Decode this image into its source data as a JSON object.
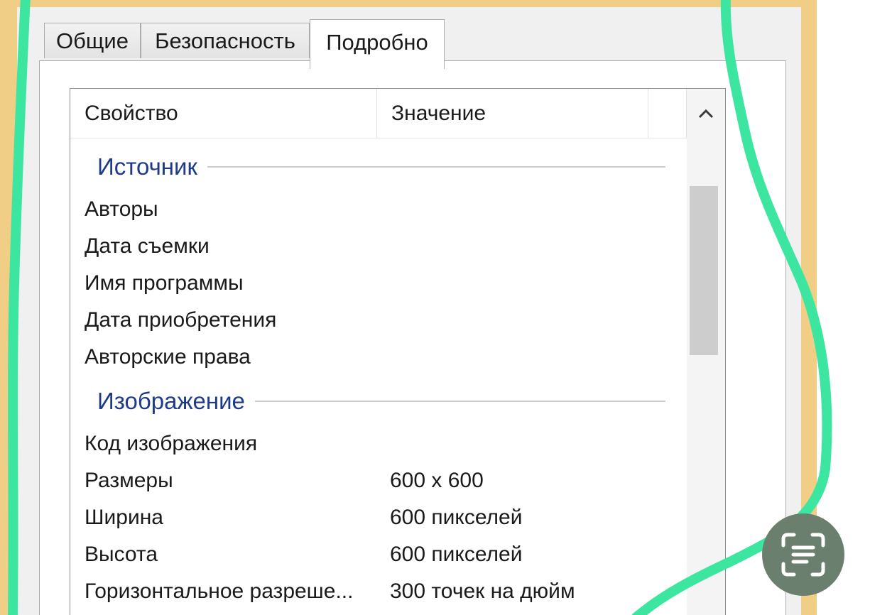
{
  "tabs": [
    {
      "label": "Общие",
      "active": false
    },
    {
      "label": "Безопасность",
      "active": false
    },
    {
      "label": "Подробно",
      "active": true
    }
  ],
  "list": {
    "columns": {
      "property": "Свойство",
      "value": "Значение"
    },
    "groups": [
      {
        "title": "Источник",
        "rows": [
          {
            "name": "Авторы",
            "value": ""
          },
          {
            "name": "Дата съемки",
            "value": ""
          },
          {
            "name": "Имя программы",
            "value": ""
          },
          {
            "name": "Дата приобретения",
            "value": ""
          },
          {
            "name": "Авторские права",
            "value": ""
          }
        ]
      },
      {
        "title": "Изображение",
        "rows": [
          {
            "name": "Код изображения",
            "value": ""
          },
          {
            "name": "Размеры",
            "value": "600 x 600"
          },
          {
            "name": "Ширина",
            "value": "600 пикселей"
          },
          {
            "name": "Высота",
            "value": "600 пикселей"
          },
          {
            "name": "Горизонтальное разреше...",
            "value": "300 точек на дюйм"
          }
        ]
      }
    ]
  },
  "icons": {
    "scroll_up": "chevron-up-icon",
    "scan_text": "scan-text-icon"
  },
  "colors": {
    "window_border": "#f0ce86",
    "group_title": "#1e3b8a",
    "annotation_stroke": "#3ce6a0",
    "scan_button": "#6b7f6e"
  }
}
